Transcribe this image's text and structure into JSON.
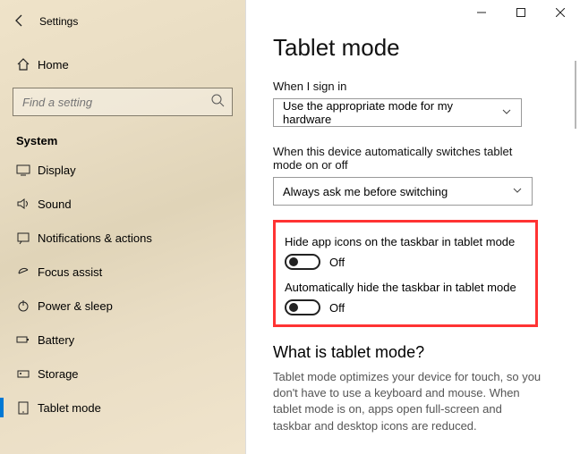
{
  "window": {
    "title": "Settings"
  },
  "sidebar": {
    "home": "Home",
    "searchPlaceholder": "Find a setting",
    "category": "System",
    "items": [
      {
        "label": "Display"
      },
      {
        "label": "Sound"
      },
      {
        "label": "Notifications & actions"
      },
      {
        "label": "Focus assist"
      },
      {
        "label": "Power & sleep"
      },
      {
        "label": "Battery"
      },
      {
        "label": "Storage"
      },
      {
        "label": "Tablet mode"
      }
    ]
  },
  "main": {
    "title": "Tablet mode",
    "signinLabel": "When I sign in",
    "signinValue": "Use the appropriate mode for my hardware",
    "switchLabel": "When this device automatically switches tablet mode on or off",
    "switchValue": "Always ask me before switching",
    "hideIconsLabel": "Hide app icons on the taskbar in tablet mode",
    "hideIconsState": "Off",
    "hideTaskbarLabel": "Automatically hide the taskbar in tablet mode",
    "hideTaskbarState": "Off",
    "whatHeading": "What is tablet mode?",
    "whatDesc": "Tablet mode optimizes your device for touch, so you don't have to use a keyboard and mouse. When tablet mode is on, apps open full-screen and taskbar and desktop icons are reduced."
  }
}
